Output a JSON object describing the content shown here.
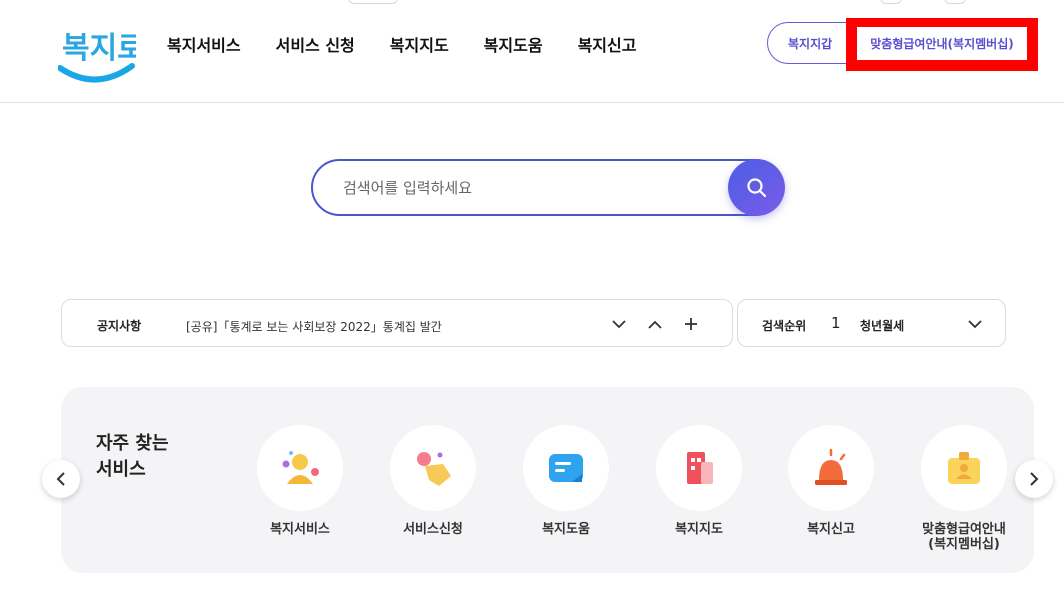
{
  "header": {
    "logo_text": "복지로",
    "nav": [
      {
        "label": "복지서비스"
      },
      {
        "label": "서비스 신청"
      },
      {
        "label": "복지지도"
      },
      {
        "label": "복지도움"
      },
      {
        "label": "복지신고"
      }
    ],
    "wallet_label": "복지지갑",
    "membership_label": "맞춤형급여안내(복지멤버십)"
  },
  "search": {
    "placeholder": "검색어를 입력하세요",
    "icon": "search-icon"
  },
  "notice": {
    "title": "공지사항",
    "text": "[공유]「통계로 보는 사회보장 2022」통계집 발간",
    "controls": [
      "chevron-down-icon",
      "chevron-up-icon",
      "plus-icon"
    ]
  },
  "ranking": {
    "title": "검색순위",
    "rank": "1",
    "keyword": "청년월세",
    "icon": "chevron-down-icon"
  },
  "favorites": {
    "title_line1": "자주 찾는",
    "title_line2": "서비스",
    "items": [
      {
        "label": "복지서비스",
        "icon": "person-icon"
      },
      {
        "label": "서비스신청",
        "icon": "hand-click-icon"
      },
      {
        "label": "복지도움",
        "icon": "chat-note-icon"
      },
      {
        "label": "복지지도",
        "icon": "building-map-icon"
      },
      {
        "label": "복지신고",
        "icon": "siren-icon"
      },
      {
        "label": "맞춤형급여안내\n(복지멤버십)",
        "icon": "id-card-icon"
      }
    ]
  },
  "colors": {
    "accent": "#5c4fcf",
    "search_border": "#4a56c9",
    "highlight": "#ff0000",
    "logo_blue": "#1aa7e8"
  }
}
